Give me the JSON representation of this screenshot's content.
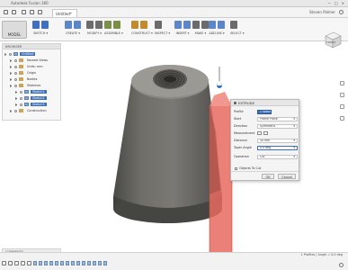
{
  "window": {
    "title": "Autodesk Fusion 360",
    "controls": [
      "−",
      "□",
      "×"
    ]
  },
  "document": {
    "tab_label": "Untitled*",
    "user": "Steven Palmer"
  },
  "ribbon": {
    "mode": "MODEL",
    "groups": [
      {
        "label": "SKETCH ▾",
        "color": "#3f6fbf",
        "icons": 2
      },
      {
        "label": "CREATE ▾",
        "color": "#5d86c9",
        "icons": 2
      },
      {
        "label": "MODIFY ▾",
        "color": "#6c6c6c",
        "icons": 2
      },
      {
        "label": "ASSEMBLE ▾",
        "color": "#7c8f46",
        "icons": 2
      },
      {
        "label": "CONSTRUCT ▾",
        "color": "#c18a2c",
        "icons": 2
      },
      {
        "label": "INSPECT ▾",
        "color": "#6b6b6b",
        "icons": 1
      },
      {
        "label": "INSERT ▾",
        "color": "#5d86c9",
        "icons": 2
      },
      {
        "label": "MAKE ▾",
        "color": "#6b6b6b",
        "icons": 2
      },
      {
        "label": "ADD-INS ▾",
        "color": "#5d86c9",
        "icons": 2
      },
      {
        "label": "SELECT ▾",
        "color": "#6b6b6b",
        "icons": 1
      }
    ]
  },
  "browser": {
    "header": "BROWSER",
    "items": [
      {
        "label": "Untitled",
        "selected": true,
        "icon": "body"
      },
      {
        "label": "Named Views",
        "selected": false,
        "icon": "folder"
      },
      {
        "label": "Units: mm",
        "selected": false,
        "icon": "folder"
      },
      {
        "label": "Origin",
        "selected": false,
        "icon": "folder"
      },
      {
        "label": "Bodies",
        "selected": false,
        "icon": "folder"
      },
      {
        "label": "Sketches",
        "selected": false,
        "icon": "folder"
      },
      {
        "label": "Sketch1",
        "selected": true,
        "icon": "body"
      },
      {
        "label": "Sketch2",
        "selected": true,
        "icon": "body"
      },
      {
        "label": "Sketch3",
        "selected": true,
        "icon": "body"
      },
      {
        "label": "Construction",
        "selected": false,
        "icon": "folder"
      }
    ]
  },
  "comments": {
    "label": "COMMENTS"
  },
  "viewcube": {
    "label": "FRONT"
  },
  "extrude_dialog": {
    "title": "EXTRUDE",
    "rows": [
      {
        "key": "Profile",
        "value": "1 selected",
        "style": "sel"
      },
      {
        "key": "Start",
        "value": "Profile Plane",
        "style": ""
      },
      {
        "key": "Direction",
        "value": "Symmetric",
        "style": ""
      },
      {
        "key": "Measurement",
        "value": "",
        "style": "icons"
      },
      {
        "key": "Distance",
        "value": "30 mm",
        "style": ""
      },
      {
        "key": "Taper Angle",
        "value": "0.0 deg",
        "style": "active"
      },
      {
        "key": "Operation",
        "value": "Cut",
        "style": ""
      }
    ],
    "objects_to_cut": "Objects To Cut",
    "ok": "OK",
    "cancel": "Cancel"
  },
  "status": {
    "profile_info": "1 Profiles | Angle = 0.0 deg"
  }
}
